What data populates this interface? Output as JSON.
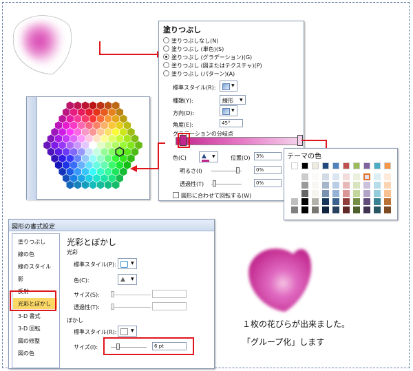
{
  "fill_dialog": {
    "title": "塗りつぶし",
    "options": [
      "塗りつぶしなし(N)",
      "塗りつぶし (単色)(S)",
      "塗りつぶし (グラデーション)(G)",
      "塗りつぶし (図またはテクスチャ)(P)",
      "塗りつぶし (パターン)(A)"
    ],
    "selected_index": 2,
    "preset_label": "標準スタイル(R):",
    "type_label": "種類(Y):",
    "type_value": "線形",
    "direction_label": "方向(D):",
    "angle_label": "角度(E):",
    "angle_value": "45°",
    "stops_label": "グラデーションの分岐点",
    "color_label": "色(C)",
    "position_label": "位置(O)",
    "position_value": "3%",
    "brightness_label": "明るさ(I)",
    "brightness_value": "0%",
    "transparency_label": "透過性(T)",
    "transparency_value": "0%",
    "rotate_label": "図形に合わせて回転する(W)"
  },
  "theme_colors": {
    "title": "テーマの色",
    "top_row": [
      "#ffffff",
      "#000000",
      "#eeece1",
      "#1f497d",
      "#4f81bd",
      "#c0504d",
      "#9bbb59",
      "#8064a2",
      "#4bacc6",
      "#f79646"
    ]
  },
  "format_dialog": {
    "title": "図形の書式設定",
    "sidebar": [
      "塗りつぶし",
      "線の色",
      "線のスタイル",
      "影",
      "反射",
      "光彩とぼかし",
      "3-D 書式",
      "3-D 回転",
      "図の修整",
      "図の色"
    ],
    "selected_index": 5,
    "heading": "光彩とぼかし",
    "glow_section": "光彩",
    "glow_preset_label": "標準スタイル(P):",
    "glow_color_label": "色(C):",
    "glow_size_label": "サイズ(S):",
    "glow_transparency_label": "透過性(T):",
    "soft_section": "ぼかし",
    "soft_preset_label": "標準スタイル(R):",
    "soft_size_label": "サイズ(I):",
    "soft_size_value": "6 pt"
  },
  "captions": {
    "line1": "１枚の花びらが出来ました。",
    "line2": "「グループ化」します"
  },
  "colors": {
    "accent_red": "#e0141b",
    "petal_pink": "#d63fb0"
  }
}
